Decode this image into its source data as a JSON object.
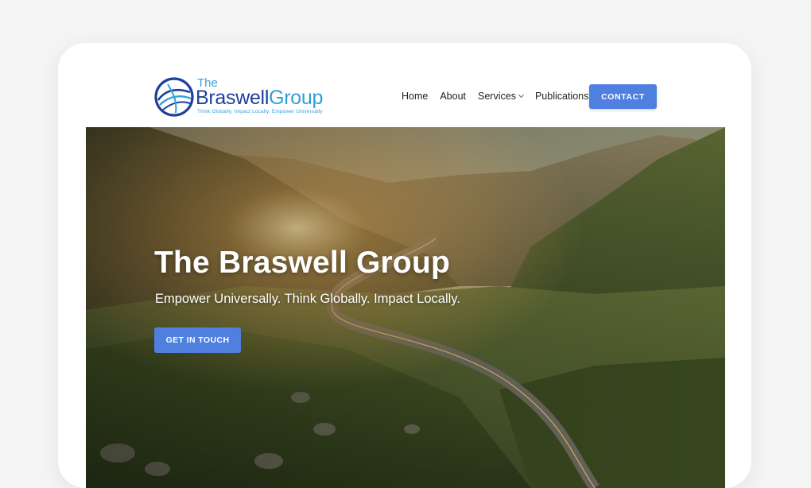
{
  "header": {
    "logo": {
      "the": "The",
      "name_part1": "Braswell",
      "name_part2": "Group",
      "tagline": "Think Globally. Impact Locally. Empower Universally"
    },
    "nav": {
      "items": [
        "Home",
        "About",
        "Services",
        "Publications"
      ],
      "services_has_dropdown": true,
      "contact_label": "CONTACT"
    }
  },
  "hero": {
    "title": "The Braswell Group",
    "subtitle": "Empower Universally. Think Globally. Impact Locally.",
    "cta_label": "GET IN TOUCH"
  },
  "colors": {
    "accent": "#4f7fdf",
    "brand_dark": "#1f3f9b",
    "brand_light": "#2f9fdc"
  },
  "icons": {
    "logo_mark": "globe-wave-logo-icon",
    "dropdown": "chevron-down-icon"
  }
}
